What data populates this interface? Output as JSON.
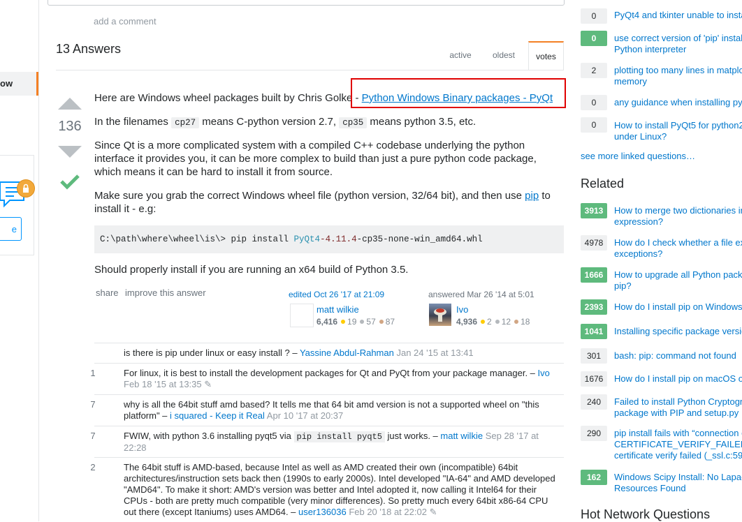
{
  "nav": {
    "active_item": "ow",
    "teams_button_text": "e"
  },
  "question": {
    "add_comment": "add a comment"
  },
  "answers": {
    "count_label": "13 Answers",
    "tabs": [
      "active",
      "oldest",
      "votes"
    ]
  },
  "answer": {
    "score": "136",
    "p1_before": "Here are Windows wheel packages built by Chris Golke - ",
    "p1_link": "Python Windows Binary packages - PyQt",
    "p2_a": "In the filenames ",
    "p2_code1": "cp27",
    "p2_b": " means C-python version 2.7, ",
    "p2_code2": "cp35",
    "p2_c": " means python 3.5, etc.",
    "p3": "Since Qt is a more complicated system with a compiled C++ codebase underlying the python interface it provides you, it can be more complex to build than just a pure python code package, which means it can be hard to install it from source.",
    "p4_a": "Make sure you grab the correct Windows wheel file (python version, 32/64 bit), and then use ",
    "p4_link": "pip",
    "p4_b": " to install it - e.g:",
    "code_prefix": "C:\\path\\where\\wheel\\is\\> pip install ",
    "code_pkg": "PyQt4",
    "code_ver": "-4.11.4",
    "code_suffix": "-cp35-none-win_amd64.whl",
    "p5": "Should properly install if you are running an x64 build of Python 3.5.",
    "menu": {
      "share": "share",
      "improve": "improve this answer"
    },
    "editor": {
      "label": "edited Oct 26 '17 at 21:09",
      "name": "matt wilkie",
      "rep": "6,416",
      "gold": "19",
      "silver": "57",
      "bronze": "87"
    },
    "author": {
      "label": "answered Mar 26 '14 at 5:01",
      "name": "Ivo",
      "rep": "4,936",
      "gold": "2",
      "silver": "12",
      "bronze": "18"
    }
  },
  "comments": [
    {
      "score": "",
      "text": "is there is pip under linux or easy install ? – ",
      "user": "Yassine Abdul-Rahman",
      "date": "Jan 24 '15 at 13:41"
    },
    {
      "score": "1",
      "text": "For linux, it is best to install the development packages for Qt and PyQt from your package manager. – ",
      "user": "Ivo",
      "date": "Feb 18 '15 at 13:35"
    },
    {
      "score": "7",
      "text": "why is all the 64bit stuff amd based? It tells me that 64 bit amd version is not a supported wheel on \"this platform\" – ",
      "user": "i squared - Keep it Real",
      "date": "Apr 10 '17 at 20:37"
    },
    {
      "score": "7",
      "text_a": "FWIW, with python 3.6 installing pyqt5 via ",
      "code": "pip install pyqt5",
      "text_b": " just works. – ",
      "user": "matt wilkie",
      "date": "Sep 28 '17 at 22:28"
    },
    {
      "score": "2",
      "text": "The 64bit stuff is AMD-based, because Intel as well as AMD created their own (incompatible) 64bit architectures/instruction sets back then (1990s to early 2000s). Intel developed \"IA-64\" and AMD developed \"AMD64\". To make it short: AMD's version was better and Intel adopted it, now calling it Intel64 for their CPUs - both are pretty much compatible (very minor differences). So pretty much every 64bit x86-64 CPU out there (except Itaniums) uses AMD64. – ",
      "user": "user136036",
      "date": "Feb 20 '18 at 22:02"
    }
  ],
  "sidebar": {
    "linked": [
      {
        "score": "0",
        "title": "PyQt4 and tkinter unable to insta",
        "accepted": false
      },
      {
        "score": "0",
        "title": "use correct version of 'pip' instal",
        "title2": "Python interpreter",
        "accepted": true
      },
      {
        "score": "2",
        "title": "plotting too many lines in matplo",
        "title2": "memory",
        "accepted": false
      },
      {
        "score": "0",
        "title": "any guidance when installing pyt",
        "accepted": false
      },
      {
        "score": "0",
        "title": "How to install PyQt5 for python2",
        "title2": "under Linux?",
        "accepted": false
      }
    ],
    "see_more": "see more linked questions…",
    "related_heading": "Related",
    "related": [
      {
        "score": "3913",
        "title": "How to merge two dictionaries in",
        "title2": "expression?",
        "accepted": true
      },
      {
        "score": "4978",
        "title": "How do I check whether a file exi",
        "title2": "exceptions?",
        "accepted": false
      },
      {
        "score": "1666",
        "title": "How to upgrade all Python packa",
        "title2": "pip?",
        "accepted": true
      },
      {
        "score": "2393",
        "title": "How do I install pip on Windows?",
        "accepted": true
      },
      {
        "score": "1041",
        "title": "Installing specific package versio",
        "accepted": true
      },
      {
        "score": "301",
        "title": "bash: pip: command not found",
        "accepted": false
      },
      {
        "score": "1676",
        "title": "How do I install pip on macOS o",
        "accepted": false
      },
      {
        "score": "240",
        "title": "Failed to install Python Cryptogr",
        "title2": "package with PIP and setup.py",
        "accepted": false
      },
      {
        "score": "290",
        "title": "pip install fails with “connection e",
        "title2": "CERTIFICATE_VERIFY_FAILED",
        "title3": "certificate verify failed (_ssl.c:59",
        "accepted": false
      },
      {
        "score": "162",
        "title": "Windows Scipy Install: No Lapac",
        "title2": "Resources Found",
        "accepted": true
      }
    ],
    "hot_heading": "Hot Network Questions"
  },
  "colors": {
    "accent": "#f48024",
    "link": "#0077cc",
    "accepted": "#5eba7d",
    "highlight": "#e00000"
  }
}
